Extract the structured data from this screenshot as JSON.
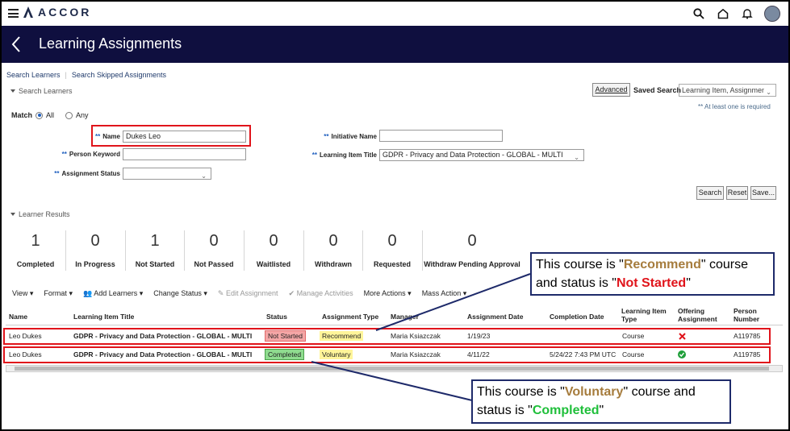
{
  "brand": "ACCOR",
  "header": {
    "title": "Learning Assignments"
  },
  "links": {
    "search_learners": "Search Learners",
    "search_skipped": "Search Skipped Assignments"
  },
  "search": {
    "section_title": "Search Learners",
    "advanced_label": "Advanced",
    "saved_search_label": "Saved Search",
    "saved_search_value": "Learning Item, Assignment",
    "required_note": "** At least one is required",
    "match_label": "Match",
    "match_all": "All",
    "match_any": "Any",
    "required_marker": "**",
    "fields": {
      "name_label": "Name",
      "name_value": "Dukes Leo",
      "person_keyword_label": "Person Keyword",
      "person_keyword_value": "",
      "assignment_status_label": "Assignment Status",
      "assignment_status_value": "",
      "initiative_name_label": "Initiative Name",
      "initiative_name_value": "",
      "learning_item_title_label": "Learning Item Title",
      "learning_item_title_value": "GDPR - Privacy and Data Protection - GLOBAL - MULTI"
    },
    "buttons": {
      "search": "Search",
      "reset": "Reset",
      "save": "Save..."
    }
  },
  "results": {
    "section_title": "Learner Results",
    "stats": [
      {
        "value": "1",
        "label": "Completed"
      },
      {
        "value": "0",
        "label": "In Progress"
      },
      {
        "value": "1",
        "label": "Not Started"
      },
      {
        "value": "0",
        "label": "Not Passed"
      },
      {
        "value": "0",
        "label": "Waitlisted"
      },
      {
        "value": "0",
        "label": "Withdrawn"
      },
      {
        "value": "0",
        "label": "Requested"
      },
      {
        "value": "0",
        "label": "Withdraw Pending Approval"
      }
    ],
    "toolbar": {
      "view": "View",
      "format": "Format",
      "add_learners": "Add Learners",
      "change_status": "Change Status",
      "edit_assignment": "Edit Assignment",
      "manage_activities": "Manage Activities",
      "more_actions": "More Actions",
      "mass_action": "Mass Action"
    },
    "columns": {
      "name": "Name",
      "learning_item_title": "Learning Item Title",
      "status": "Status",
      "assignment_type": "Assignment Type",
      "manager": "Manager",
      "assignment_date": "Assignment Date",
      "completion_date": "Completion Date",
      "learning_item_type_1": "Learning Item",
      "learning_item_type_2": "Type",
      "offering_assignment_1": "Offering",
      "offering_assignment_2": "Assignment",
      "person_number_1": "Person",
      "person_number_2": "Number"
    },
    "rows": [
      {
        "name": "Leo Dukes",
        "title": "GDPR - Privacy and Data Protection - GLOBAL - MULTI",
        "status": "Not Started",
        "status_color": "#f4a6a6",
        "assignment_type": "Recommend",
        "manager": "Maria Ksiazczak",
        "assignment_date": "1/19/23",
        "completion_date": "",
        "item_type": "Course",
        "offering_icon": "x-icon",
        "person_number": "A119785"
      },
      {
        "name": "Leo Dukes",
        "title": "GDPR - Privacy and Data Protection - GLOBAL - MULTI",
        "status": "Completed",
        "status_color": "#8fdc8f",
        "assignment_type": "Voluntary",
        "manager": "Maria Ksiazczak",
        "assignment_date": "4/11/22",
        "completion_date": "5/24/22 7:43 PM UTC",
        "item_type": "Course",
        "offering_icon": "check-circle-icon",
        "person_number": "A119785"
      }
    ]
  },
  "callouts": {
    "first": {
      "pre": "This course is \"",
      "type": "Recommend",
      "mid": "\" course and status is \"",
      "status": "Not Started",
      "post": "\""
    },
    "second": {
      "pre": "This course is \"",
      "type": "Voluntary",
      "mid": "\" course and status is \"",
      "status": "Completed",
      "post": "\""
    }
  },
  "colors": {
    "header_bg": "#0f0f3f",
    "highlight_red": "#e0141b",
    "recommend_gold": "#a67c3d",
    "not_started_red": "#e0141b",
    "completed_green": "#1fbf3a",
    "assignment_badge_yellow": "#fff59a"
  }
}
